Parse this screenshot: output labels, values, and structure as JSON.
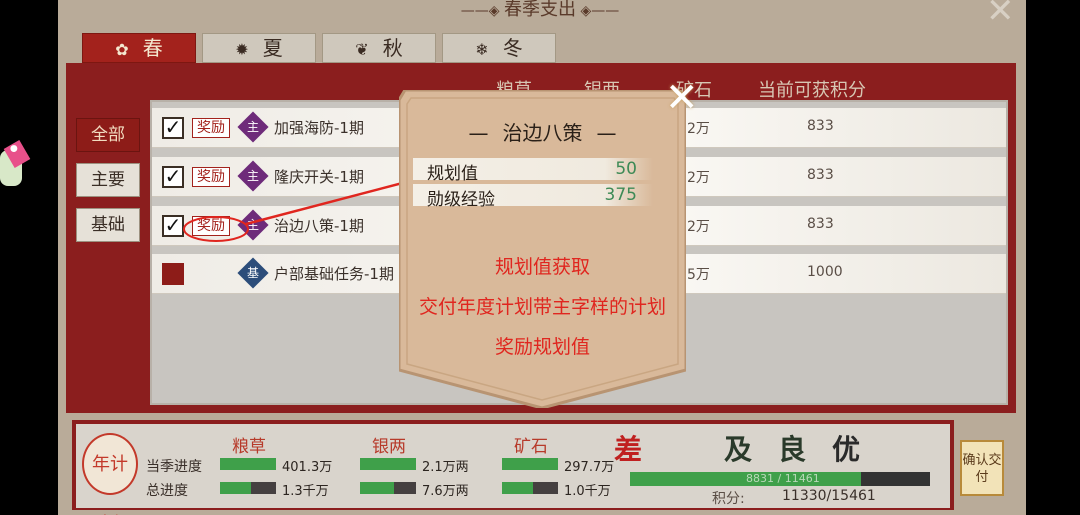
{
  "window": {
    "title": "春季支出",
    "close_icon": "close-icon"
  },
  "seasons": [
    {
      "label": "春",
      "icon": "flower-icon",
      "active": true
    },
    {
      "label": "夏",
      "icon": "sun-icon",
      "active": false
    },
    {
      "label": "秋",
      "icon": "leaf-icon",
      "active": false
    },
    {
      "label": "冬",
      "icon": "snowflake-icon",
      "active": false
    }
  ],
  "columns": {
    "grain": "粮草",
    "silver": "银两",
    "ore": "矿石",
    "points": "当前可获积分"
  },
  "filters": [
    {
      "label": "全部",
      "active": true
    },
    {
      "label": "主要",
      "active": false
    },
    {
      "label": "基础",
      "active": false
    }
  ],
  "tasks": [
    {
      "checked": true,
      "reward": "奖励",
      "tag": "主",
      "name": "加强海防-1期",
      "value": "2万",
      "points": "833"
    },
    {
      "checked": true,
      "reward": "奖励",
      "tag": "主",
      "name": "隆庆开关-1期",
      "value": "2万",
      "points": "833"
    },
    {
      "checked": true,
      "reward": "奖励",
      "tag": "主",
      "name": "治边八策-1期",
      "value": "2万",
      "points": "833"
    },
    {
      "checked": false,
      "reward": "",
      "tag": "基",
      "name": "户部基础任务-1期",
      "value": "5万",
      "points": "1000"
    }
  ],
  "popup": {
    "title": "治边八策",
    "rows": [
      {
        "label": "规划值",
        "value": "50"
      },
      {
        "label": "勋级经验",
        "value": "375"
      }
    ],
    "notes": [
      "规划值获取",
      "交付年度计划带主字样的计划",
      "奖励规划值"
    ]
  },
  "bottom": {
    "badge": "年计划",
    "resources": [
      {
        "name": "粮草",
        "season": "401.3万",
        "season_ratio": 1.0,
        "total": "1.3千万",
        "total_ratio": 0.55
      },
      {
        "name": "银两",
        "season": "2.1万两",
        "season_ratio": 1.0,
        "total": "7.6万两",
        "total_ratio": 0.6
      },
      {
        "name": "矿石",
        "season": "297.7万",
        "season_ratio": 1.0,
        "total": "1.0千万",
        "total_ratio": 0.55
      }
    ],
    "season_label": "当季进度",
    "total_label": "总进度",
    "grades": [
      "差",
      "及",
      "良",
      "优"
    ],
    "score_bar_text": "8831 / 11461",
    "score_ratio": 0.77,
    "score_label": "积分:",
    "score_value": "11330/15461",
    "confirm": "确认交付"
  },
  "colors": {
    "accent_red": "#8b1e1e",
    "progress_green": "#3fa04a",
    "annot_red": "#e0261f"
  }
}
